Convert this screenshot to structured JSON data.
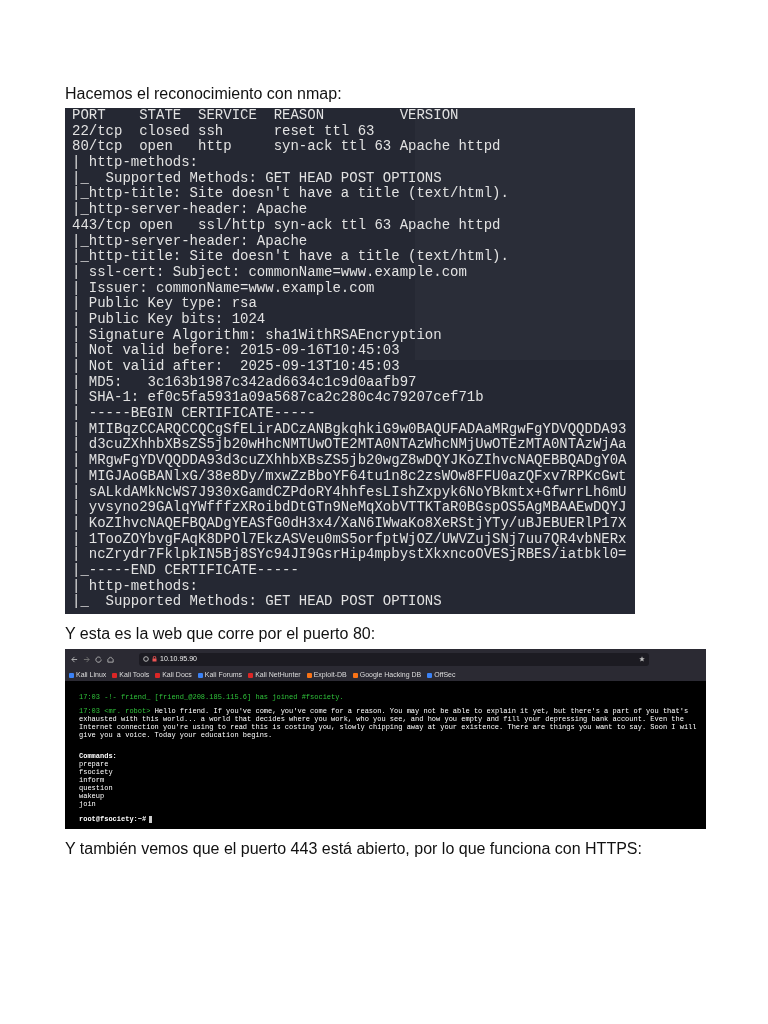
{
  "caption_1": "Hacemos el reconocimiento con nmap:",
  "nmap_output": {
    "lines": [
      "PORT    STATE  SERVICE  REASON         VERSION",
      "22/tcp  closed ssh      reset ttl 63",
      "80/tcp  open   http     syn-ack ttl 63 Apache httpd",
      "| http-methods:",
      "|_  Supported Methods: GET HEAD POST OPTIONS",
      "|_http-title: Site doesn't have a title (text/html).",
      "|_http-server-header: Apache",
      "443/tcp open   ssl/http syn-ack ttl 63 Apache httpd",
      "|_http-server-header: Apache",
      "|_http-title: Site doesn't have a title (text/html).",
      "| ssl-cert: Subject: commonName=www.example.com",
      "| Issuer: commonName=www.example.com",
      "| Public Key type: rsa",
      "| Public Key bits: 1024",
      "| Signature Algorithm: sha1WithRSAEncryption",
      "| Not valid before: 2015-09-16T10:45:03",
      "| Not valid after:  2025-09-13T10:45:03",
      "| MD5:   3c163b1987c342ad6634c1c9d0aafb97",
      "| SHA-1: ef0c5fa5931a09a5687ca2c280c4c79207cef71b",
      "| -----BEGIN CERTIFICATE-----",
      "| MIIBqzCCARQCCQCgSfELirADCzANBgkqhkiG9w0BAQUFADAaMRgwFgYDVQQDDA93",
      "| d3cuZXhhbXBsZS5jb20wHhcNMTUwOTE2MTA0NTAzWhcNMjUwOTEzMTA0NTAzWjAa",
      "| MRgwFgYDVQQDDA93d3cuZXhhbXBsZS5jb20wgZ8wDQYJKoZIhvcNAQEBBQADgY0A",
      "| MIGJAoGBANlxG/38e8Dy/mxwZzBboYF64tu1n8c2zsWOw8FFU0azQFxv7RPKcGwt",
      "| sALkdAMkNcWS7J930xGamdCZPdoRY4hhfesLIshZxpyk6NoYBkmtx+GfwrrLh6mU",
      "| yvsyno29GAlqYWfffzXRoibdDtGTn9NeMqXobVTTKTaR0BGspOS5AgMBAAEwDQYJ",
      "| KoZIhvcNAQEFBQADgYEASfG0dH3x4/XaN6IWwaKo8XeRStjYTy/uBJEBUERlP17X",
      "| 1TooZOYbvgFAqK8DPOl7EkzASVeu0mS5orfptWjOZ/UWVZujSNj7uu7QR4vbNERx",
      "| ncZrydr7FklpkIN5Bj8SYc94JI9GsrHip4mpbystXkxncoOVESjRBES/iatbkl0=",
      "|_-----END CERTIFICATE-----",
      "| http-methods:",
      "|_  Supported Methods: GET HEAD POST OPTIONS"
    ]
  },
  "caption_2": "Y esta es la web que corre por el puerto 80:",
  "browser": {
    "url": "10.10.95.90",
    "bookmarks": [
      {
        "label": "Kali Linux",
        "color": "#3b82f6"
      },
      {
        "label": "Kali Tools",
        "color": "#dc2626"
      },
      {
        "label": "Kali Docs",
        "color": "#dc2626"
      },
      {
        "label": "Kali Forums",
        "color": "#3b82f6"
      },
      {
        "label": "Kali NetHunter",
        "color": "#dc2626"
      },
      {
        "label": "Exploit-DB",
        "color": "#f97316"
      },
      {
        "label": "Google Hacking DB",
        "color": "#f97316"
      },
      {
        "label": "OffSec",
        "color": "#3b82f6"
      }
    ],
    "chat": [
      {
        "kind": "join",
        "time": "17:03",
        "nick": "-!-",
        "text": "friend_ [friend_@208.185.115.6] has joined #fsociety."
      },
      {
        "kind": "message",
        "time": "17:03",
        "nick": "<mr. robot>",
        "text": "Hello friend. If you've come, you've come for a reason. You may not be able to explain it yet, but there's a part of you that's exhausted with this world... a world that decides where you work, who you see, and how you empty and fill your depressing bank account. Even the Internet connection you're using to read this is costing you, slowly chipping away at your existence. There are things you want to say. Soon I will give you a voice. Today your education begins."
      }
    ],
    "commands_heading": "Commands:",
    "commands": [
      "prepare",
      "fsociety",
      "inform",
      "question",
      "wakeup",
      "join"
    ],
    "prompt": "root@fsociety:~#"
  },
  "caption_3": "Y también vemos que el puerto 443 está abierto, por lo que funciona con HTTPS:"
}
